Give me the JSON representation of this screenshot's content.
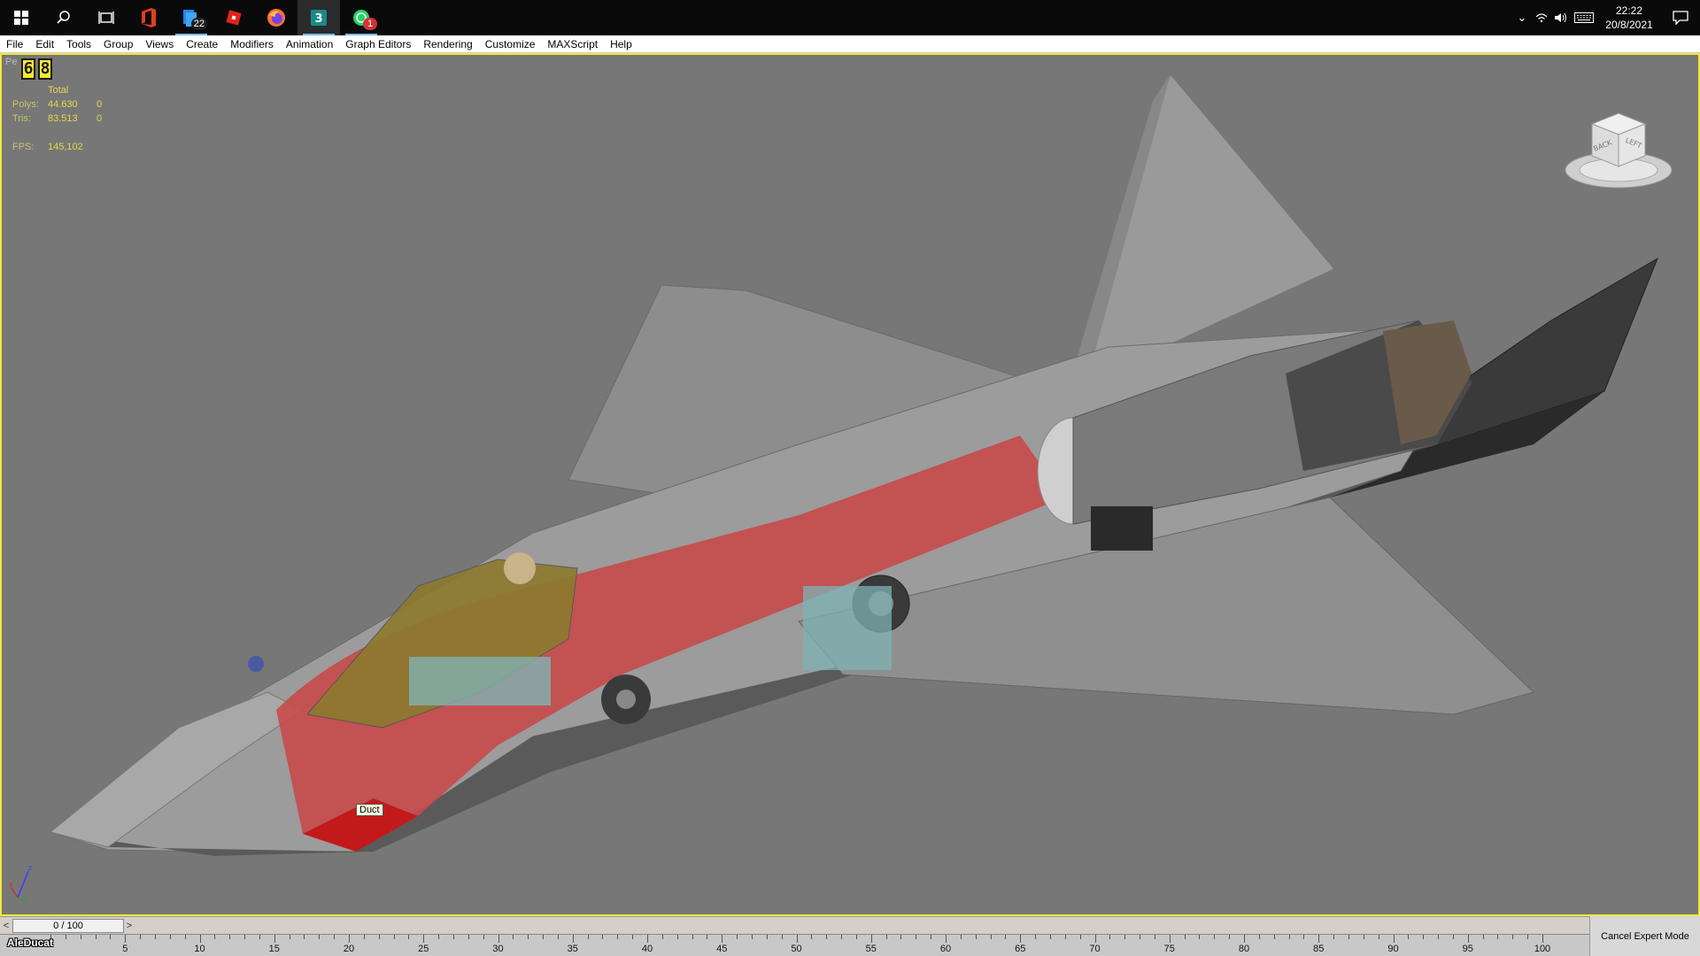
{
  "taskbar": {
    "apps": [
      {
        "name": "start-button",
        "icon": "windows-icon",
        "badge": ""
      },
      {
        "name": "search-button",
        "icon": "search-icon",
        "badge": ""
      },
      {
        "name": "task-view-button",
        "icon": "task-view-icon",
        "badge": ""
      },
      {
        "name": "office-app",
        "icon": "office-icon",
        "badge": ""
      },
      {
        "name": "store-app",
        "icon": "store-icon",
        "badge": "22"
      },
      {
        "name": "roblox-app",
        "icon": "roblox-icon",
        "badge": ""
      },
      {
        "name": "firefox-app",
        "icon": "firefox-icon",
        "badge": ""
      },
      {
        "name": "3dsmax-app",
        "icon": "3dsmax-icon",
        "badge": ""
      },
      {
        "name": "whatsapp-app",
        "icon": "whatsapp-icon",
        "badge": "1"
      }
    ],
    "clock_time": "22:22",
    "clock_date": "20/8/2021"
  },
  "menu": [
    "File",
    "Edit",
    "Tools",
    "Group",
    "Views",
    "Create",
    "Modifiers",
    "Animation",
    "Graph Editors",
    "Rendering",
    "Customize",
    "MAXScript",
    "Help"
  ],
  "viewport": {
    "label": "Pe",
    "counter_digits": [
      "6",
      "8"
    ],
    "stats": {
      "header": "Total",
      "rows": [
        {
          "key": "Polys:",
          "total": "44.630",
          "sel": "0"
        },
        {
          "key": "Tris:",
          "total": "83.513",
          "sel": "0"
        }
      ],
      "fps_key": "FPS:",
      "fps_value": "145,102"
    },
    "tooltip": "Duct",
    "viewcube_faces": [
      "BACK",
      "LEFT"
    ],
    "colors": {
      "background": "#777777",
      "border": "#f4e93a",
      "stats_text": "#e8d84a",
      "duct": "#c84a4a",
      "canopy": "#8c7a2e"
    }
  },
  "timeline": {
    "slider_value": "0 / 100",
    "ticks": [
      "5",
      "10",
      "15",
      "20",
      "25",
      "30",
      "35",
      "40",
      "45",
      "50",
      "55",
      "60",
      "65",
      "70",
      "75",
      "80",
      "85",
      "90",
      "95",
      "100"
    ],
    "status_button": "Cancel Expert Mode",
    "watermark": "AleDucat"
  }
}
